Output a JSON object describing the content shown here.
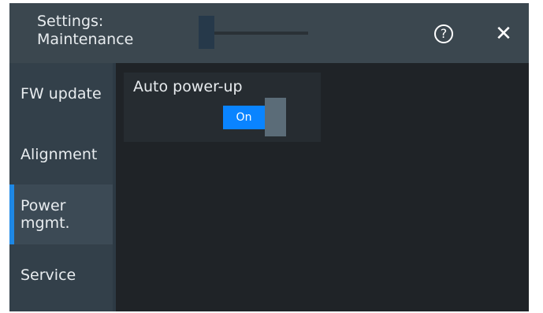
{
  "header": {
    "title": "Settings:\nMaintenance",
    "help_glyph": "?",
    "close_glyph": "✕",
    "help_icon": "help-circle-icon",
    "close_icon": "close-icon"
  },
  "sidebar": {
    "items": [
      {
        "label": "FW update",
        "active": false
      },
      {
        "label": "Alignment",
        "active": false
      },
      {
        "label": "Power\nmgmt.",
        "active": true
      },
      {
        "label": "Service",
        "active": false
      }
    ]
  },
  "main": {
    "setting_label": "Auto power-up",
    "toggle_state": "On"
  },
  "colors": {
    "accent": "#1e88e5",
    "toggle_on": "#0a84ff",
    "header_bg": "#3b474f",
    "sidebar_bg": "#33404a",
    "content_bg": "#1f2327"
  }
}
